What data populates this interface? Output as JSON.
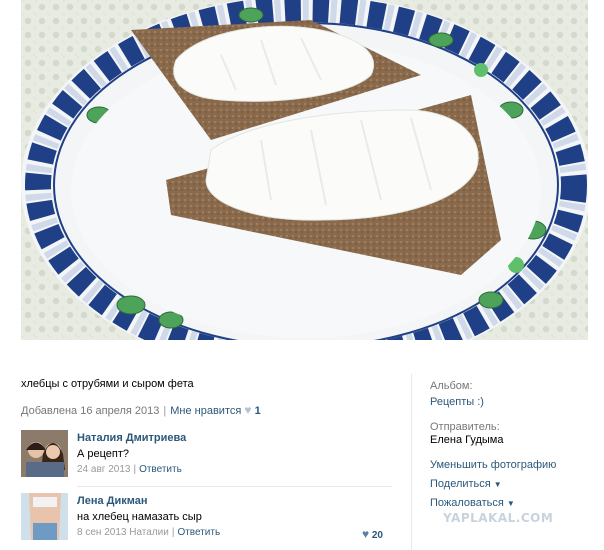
{
  "photo": {
    "description_icon": "photo-of-crispbread-with-cheese-icon"
  },
  "post": {
    "caption": "хлебцы с отрубями и сыром фета",
    "added_date": "Добавлена 16 апреля 2013",
    "like_label": "Мне нравится",
    "like_count": "1"
  },
  "comments": [
    {
      "author": "Наталия Дмитриева",
      "text": "А рецепт?",
      "date": "24 авг 2013",
      "reply_label": "Ответить"
    },
    {
      "author": "Лена Дикман",
      "text": "на хлебец намазать сыр",
      "date": "8 сен 2013 Наталии",
      "reply_label": "Ответить",
      "likes": "20"
    }
  ],
  "sidebar": {
    "album_label": "Альбом:",
    "album_value": "Рецепты :)",
    "sender_label": "Отправитель:",
    "sender_value": "Елена Гудыма",
    "shrink_label": "Уменьшить фотографию",
    "share_label": "Поделиться",
    "report_label": "Пожаловаться"
  },
  "watermark": "YAPLAKAL.COM",
  "colors": {
    "link": "#2B587A",
    "muted": "#777777",
    "plate_blue": "#1f3f86",
    "leaf_green": "#4ea35a"
  }
}
